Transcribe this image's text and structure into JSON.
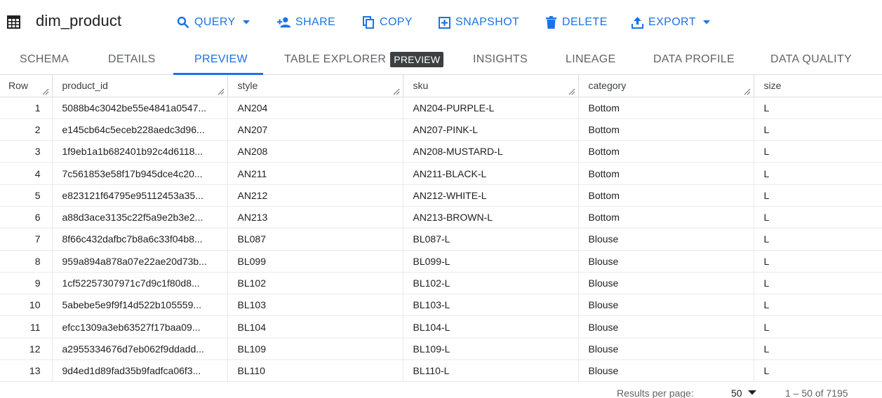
{
  "header": {
    "title": "dim_product",
    "actions": [
      {
        "label": "QUERY",
        "icon": "search-icon",
        "has_caret": true
      },
      {
        "label": "SHARE",
        "icon": "person-add-icon",
        "has_caret": false
      },
      {
        "label": "COPY",
        "icon": "copy-icon",
        "has_caret": false
      },
      {
        "label": "SNAPSHOT",
        "icon": "snapshot-icon",
        "has_caret": false
      },
      {
        "label": "DELETE",
        "icon": "trash-icon",
        "has_caret": false
      },
      {
        "label": "EXPORT",
        "icon": "upload-icon",
        "has_caret": true
      }
    ]
  },
  "tabs": [
    {
      "label": "SCHEMA",
      "active": false
    },
    {
      "label": "DETAILS",
      "active": false
    },
    {
      "label": "PREVIEW",
      "active": true
    },
    {
      "label": "TABLE EXPLORER",
      "chip": "PREVIEW",
      "active": false
    },
    {
      "label": "INSIGHTS",
      "active": false
    },
    {
      "label": "LINEAGE",
      "active": false
    },
    {
      "label": "DATA PROFILE",
      "active": false
    },
    {
      "label": "DATA QUALITY",
      "active": false
    }
  ],
  "table": {
    "columns": [
      "Row",
      "product_id",
      "style",
      "sku",
      "category",
      "size"
    ],
    "rows": [
      [
        "1",
        "5088b4c3042be55e4841a0547...",
        "AN204",
        "AN204-PURPLE-L",
        "Bottom",
        "L"
      ],
      [
        "2",
        "e145cb64c5eceb228aedc3d96...",
        "AN207",
        "AN207-PINK-L",
        "Bottom",
        "L"
      ],
      [
        "3",
        "1f9eb1a1b682401b92c4d6118...",
        "AN208",
        "AN208-MUSTARD-L",
        "Bottom",
        "L"
      ],
      [
        "4",
        "7c561853e58f17b945dce4c20...",
        "AN211",
        "AN211-BLACK-L",
        "Bottom",
        "L"
      ],
      [
        "5",
        "e823121f64795e95112453a35...",
        "AN212",
        "AN212-WHITE-L",
        "Bottom",
        "L"
      ],
      [
        "6",
        "a88d3ace3135c22f5a9e2b3e2...",
        "AN213",
        "AN213-BROWN-L",
        "Bottom",
        "L"
      ],
      [
        "7",
        "8f66c432dafbc7b8a6c33f04b8...",
        "BL087",
        "BL087-L",
        "Blouse",
        "L"
      ],
      [
        "8",
        "959a894a878a07e22ae20d73b...",
        "BL099",
        "BL099-L",
        "Blouse",
        "L"
      ],
      [
        "9",
        "1cf52257307971c7d9c1f80d8...",
        "BL102",
        "BL102-L",
        "Blouse",
        "L"
      ],
      [
        "10",
        "5abebe5e9f9f14d522b105559...",
        "BL103",
        "BL103-L",
        "Blouse",
        "L"
      ],
      [
        "11",
        "efcc1309a3eb63527f17baa09...",
        "BL104",
        "BL104-L",
        "Blouse",
        "L"
      ],
      [
        "12",
        "a2955334676d7eb062f9ddadd...",
        "BL109",
        "BL109-L",
        "Blouse",
        "L"
      ],
      [
        "13",
        "9d4ed1d89fad35b9fadfca06f3...",
        "BL110",
        "BL110-L",
        "Blouse",
        "L"
      ]
    ]
  },
  "footer": {
    "results_per_page_label": "Results per page:",
    "results_per_page_value": "50",
    "range_text": "1 – 50 of 7195"
  },
  "colors": {
    "accent": "#1a73e8",
    "chip_bg": "#3c4043",
    "text": "#202124",
    "muted": "#5f6368",
    "border": "#dadce0"
  }
}
